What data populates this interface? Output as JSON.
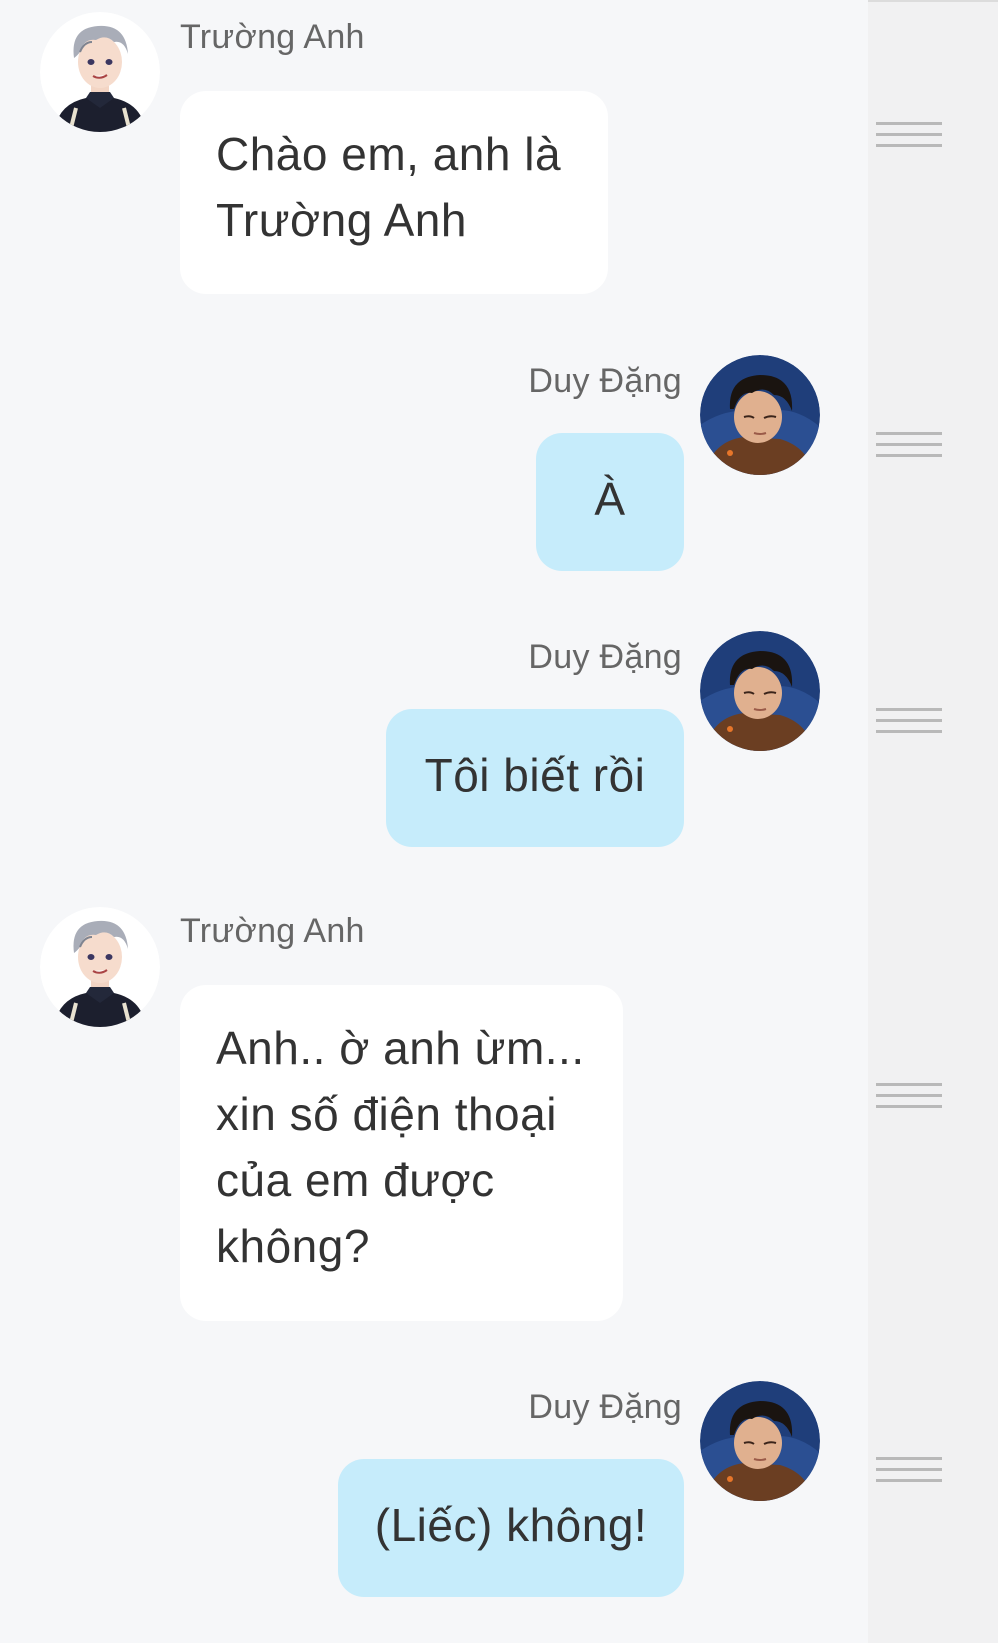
{
  "messages": [
    {
      "sender": "Trường Anh",
      "side": "left",
      "text": "Chào em, anh là Trường Anh",
      "avatar_icon": "silver-hair-character-avatar"
    },
    {
      "sender": "Duy Đặng",
      "side": "right",
      "text": "À",
      "avatar_icon": "dark-hair-character-avatar"
    },
    {
      "sender": "Duy Đặng",
      "side": "right",
      "text": "Tôi biết rồi",
      "avatar_icon": "dark-hair-character-avatar"
    },
    {
      "sender": "Trường Anh",
      "side": "left",
      "text": "Anh.. ờ anh ừm... xin số điện thoại của em được không?",
      "avatar_icon": "silver-hair-character-avatar"
    },
    {
      "sender": "Duy Đặng",
      "side": "right",
      "text": "(Liếc) không!",
      "avatar_icon": "dark-hair-character-avatar"
    }
  ],
  "menu_icon": "drag-handle-icon",
  "colors": {
    "background": "#f6f7f9",
    "gutter": "#f1f1f2",
    "left_bubble": "#ffffff",
    "right_bubble": "#c6ecfb",
    "sender_text": "#666666",
    "message_text": "#333333"
  }
}
